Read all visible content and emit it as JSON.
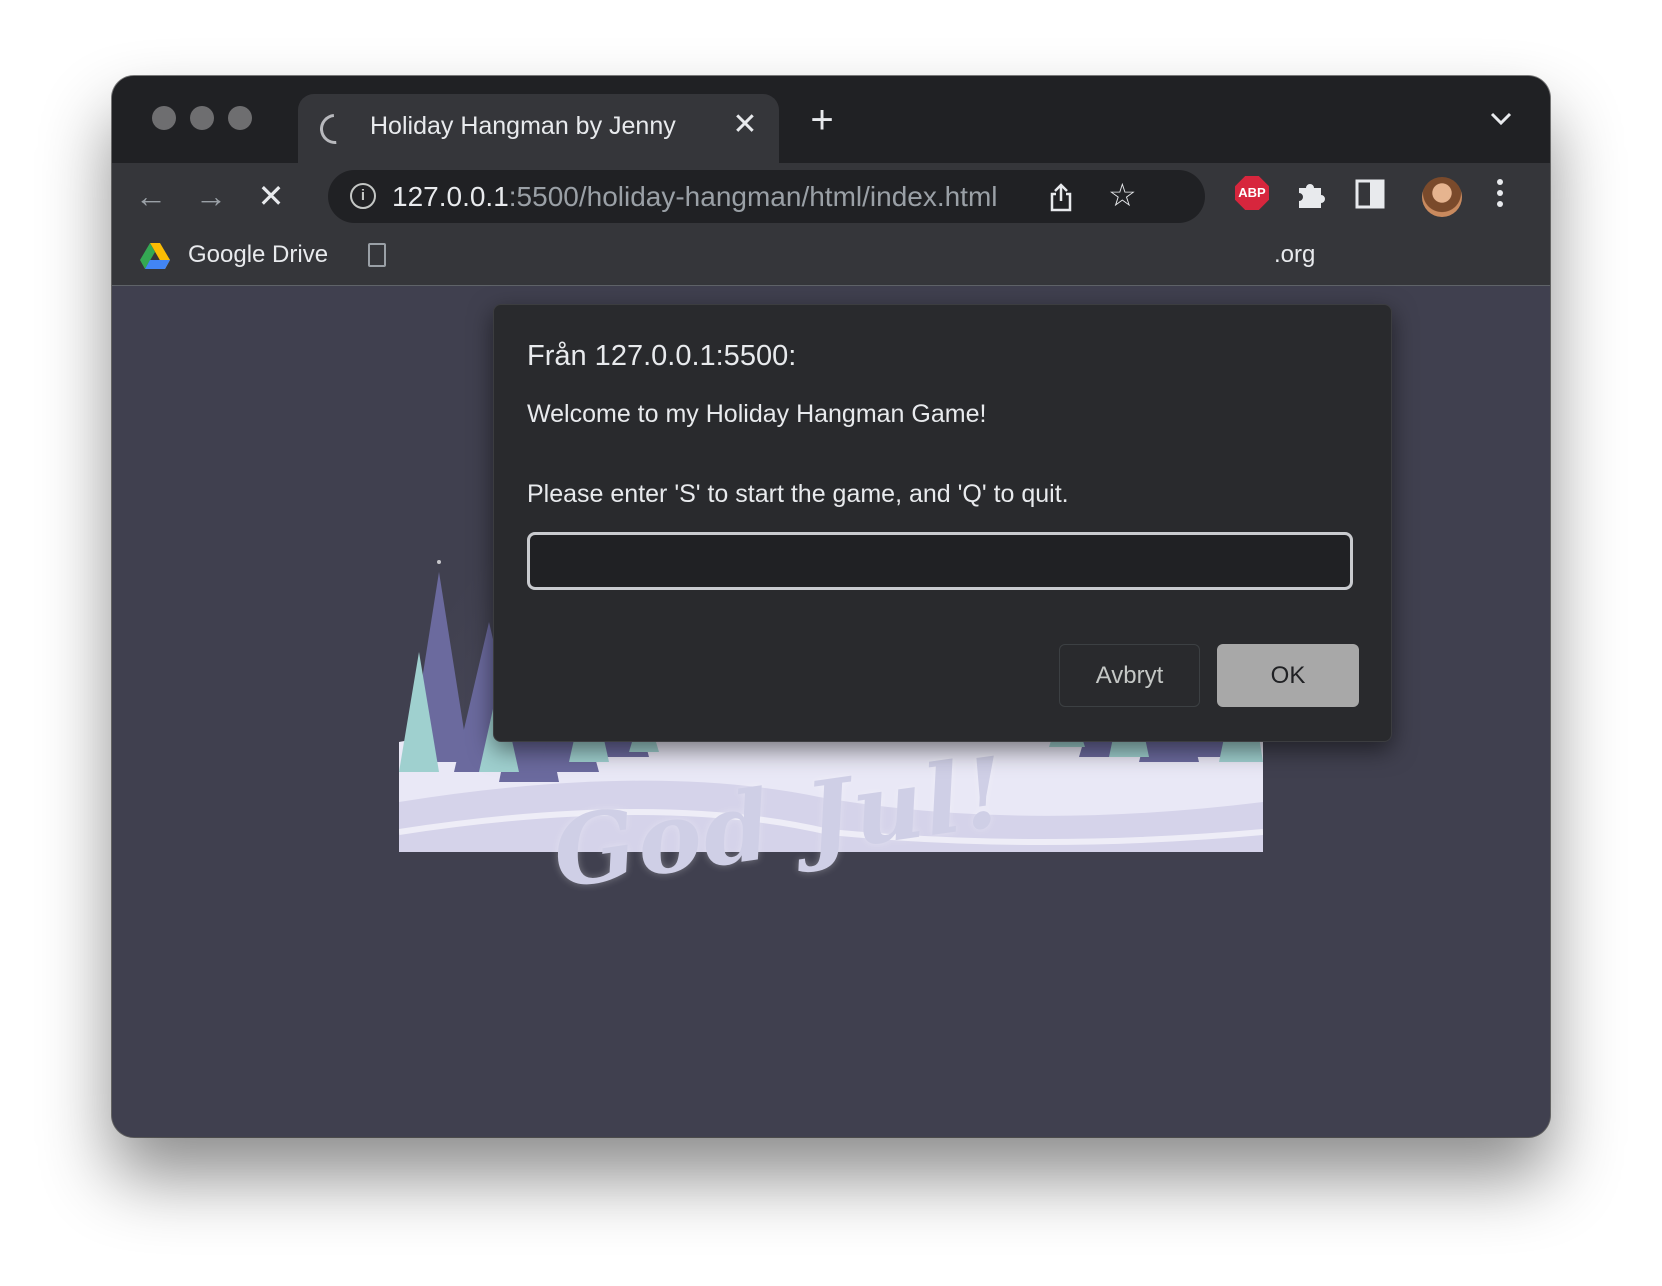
{
  "browser": {
    "tab": {
      "title": "Holiday Hangman by Jenny"
    },
    "address": {
      "host": "127.0.0.1",
      "path": ":5500/holiday-hangman/html/index.html"
    },
    "extensions": {
      "abp_label": "ABP"
    },
    "bookmarks": {
      "drive": "Google Drive",
      "truncated": ".org"
    }
  },
  "dialog": {
    "origin": "Från 127.0.0.1:5500:",
    "message_line1": "Welcome to my Holiday Hangman Game!",
    "message_line2": "Please enter 'S' to start the game, and 'Q' to quit.",
    "input_value": "",
    "cancel_label": "Avbryt",
    "ok_label": "OK"
  },
  "page": {
    "greeting": "God Jul!"
  },
  "colors": {
    "content_bg": "#40404f",
    "moon": "#f3ecb8",
    "snow": "#e9e8f6",
    "tree_dark": "#6b6a9e",
    "tree_light": "#9fd0cf"
  }
}
